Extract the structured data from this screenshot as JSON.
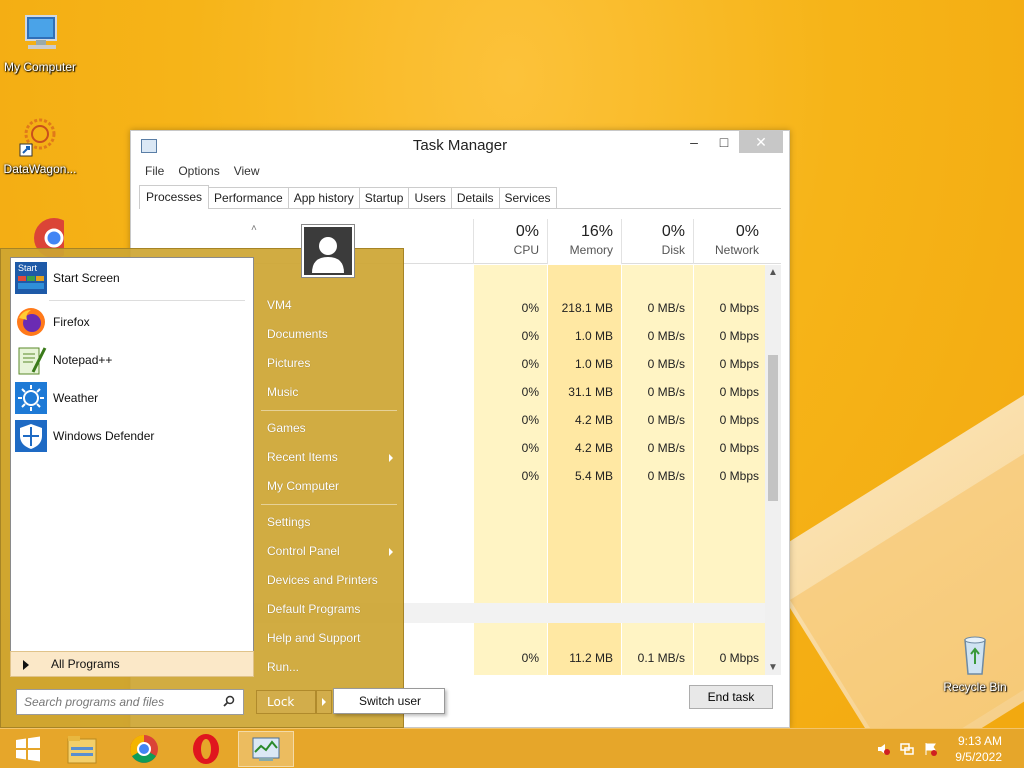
{
  "desktop": {
    "icons": [
      {
        "label": "My Computer",
        "icon": "computer-icon"
      },
      {
        "label": "DataWagon...",
        "icon": "datawagon-icon"
      },
      {
        "label": "Recycle Bin",
        "icon": "recycle-bin-icon"
      }
    ]
  },
  "task_manager": {
    "title": "Task Manager",
    "menu": [
      "File",
      "Options",
      "View"
    ],
    "tabs": [
      "Processes",
      "Performance",
      "App history",
      "Startup",
      "Users",
      "Details",
      "Services"
    ],
    "active_tab": "Processes",
    "columns": [
      {
        "pct": "0%",
        "label": "CPU"
      },
      {
        "pct": "16%",
        "label": "Memory"
      },
      {
        "pct": "0%",
        "label": "Disk"
      },
      {
        "pct": "0%",
        "label": "Network"
      }
    ],
    "rows": [
      {
        "cpu": "0%",
        "memory": "218.1 MB",
        "disk": "0 MB/s",
        "network": "0 Mbps"
      },
      {
        "cpu": "0%",
        "memory": "1.0 MB",
        "disk": "0 MB/s",
        "network": "0 Mbps"
      },
      {
        "cpu": "0%",
        "memory": "1.0 MB",
        "disk": "0 MB/s",
        "network": "0 Mbps"
      },
      {
        "cpu": "0%",
        "memory": "31.1 MB",
        "disk": "0 MB/s",
        "network": "0 Mbps"
      },
      {
        "cpu": "0%",
        "memory": "4.2 MB",
        "disk": "0 MB/s",
        "network": "0 Mbps"
      },
      {
        "cpu": "0%",
        "memory": "4.2 MB",
        "disk": "0 MB/s",
        "network": "0 Mbps"
      },
      {
        "cpu": "0%",
        "memory": "5.4 MB",
        "disk": "0 MB/s",
        "network": "0 Mbps"
      }
    ],
    "last_row": {
      "cpu": "0%",
      "memory": "11.2 MB",
      "disk": "0.1 MB/s",
      "network": "0 Mbps"
    },
    "end_task_label": "End task"
  },
  "start_menu": {
    "pinned": [
      {
        "label": "Start Screen",
        "icon": "start-screen-icon",
        "badge": "Start"
      },
      {
        "label": "Firefox",
        "icon": "firefox-icon"
      },
      {
        "label": "Notepad++",
        "icon": "notepadpp-icon"
      },
      {
        "label": "Weather",
        "icon": "weather-icon"
      },
      {
        "label": "Windows Defender",
        "icon": "windows-defender-icon"
      }
    ],
    "all_programs": "All Programs",
    "search_placeholder": "Search programs and files",
    "right_items": {
      "vm4": "VM4",
      "documents": "Documents",
      "pictures": "Pictures",
      "music": "Music",
      "games": "Games",
      "recent_items": "Recent Items",
      "my_computer": "My Computer",
      "settings": "Settings",
      "control_panel": "Control Panel",
      "devices_printers": "Devices and Printers",
      "default_programs": "Default Programs",
      "help_support": "Help and Support",
      "run": "Run..."
    },
    "lock_label": "Lock",
    "switch_user_label": "Switch user"
  },
  "taskbar": {
    "time": "9:13 AM",
    "date": "9/5/2022",
    "apps": [
      "start-icon",
      "file-explorer-icon",
      "chrome-icon",
      "opera-icon",
      "task-manager-icon"
    ]
  },
  "colors": {
    "wallpaper": "#f6b418",
    "start_menu_bg": "#cda532",
    "memory_col": "#ffe8a3",
    "other_col": "#fff4c4"
  }
}
